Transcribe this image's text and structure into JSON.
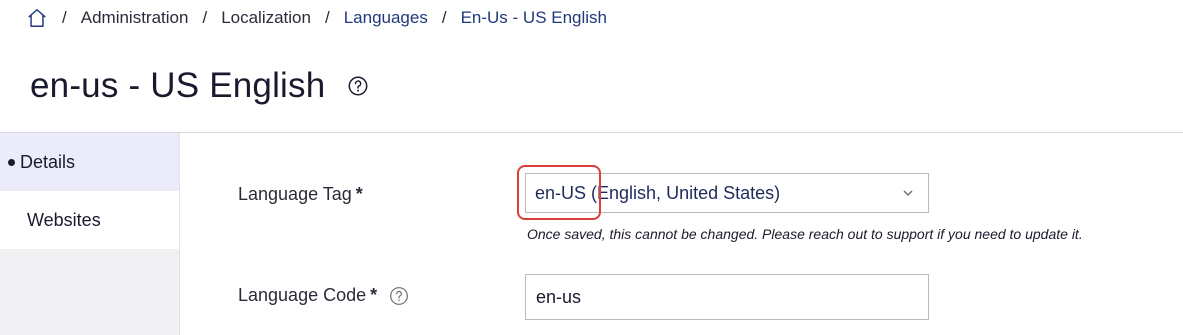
{
  "breadcrumb": {
    "home_icon": "home-icon",
    "separator": "/",
    "items": [
      {
        "label": "Administration",
        "link": false
      },
      {
        "label": "Localization",
        "link": false
      },
      {
        "label": "Languages",
        "link": true
      },
      {
        "label": "En-Us - US English",
        "link": true
      }
    ]
  },
  "page": {
    "title": "en-us - US English",
    "help_icon": "question-circle-icon"
  },
  "sidebar": {
    "items": [
      {
        "label": "Details",
        "active": true
      },
      {
        "label": "Websites",
        "active": false
      }
    ]
  },
  "form": {
    "language_tag": {
      "label": "Language Tag",
      "required_mark": "*",
      "tag_value": "en-US",
      "tag_description": "(English, United States)",
      "hint": "Once saved, this cannot be changed. Please reach out to support if you need to update it."
    },
    "language_code": {
      "label": "Language Code",
      "required_mark": "*",
      "value": "en-us",
      "help_icon": "question-circle-icon"
    }
  },
  "colors": {
    "highlight": "#d9403a",
    "link": "#1f3a7a",
    "active_sidebar": "#ebebf9"
  }
}
